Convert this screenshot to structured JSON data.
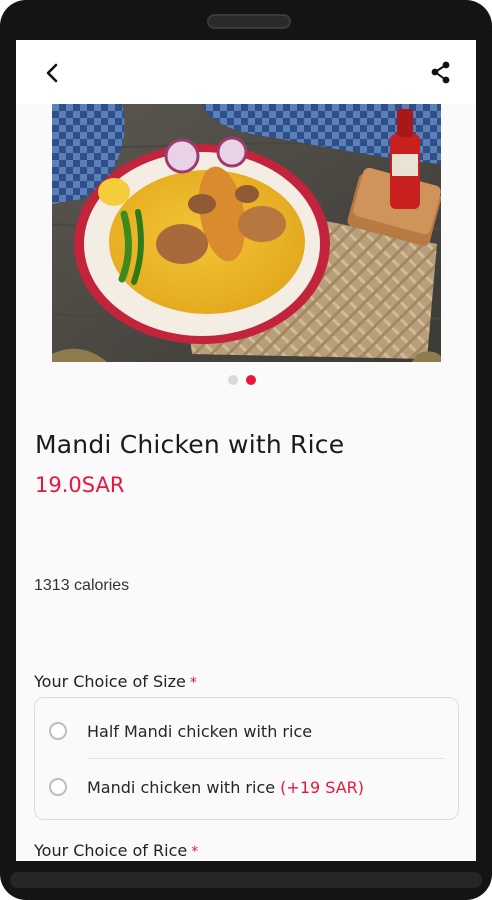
{
  "product": {
    "name": "Mandi Chicken with Rice",
    "price": "19.0SAR",
    "calories": "1313 calories"
  },
  "icons": {
    "back": "arrow-back-icon",
    "share": "share-icon"
  },
  "carousel": {
    "slide_count": 2,
    "active_index": 1
  },
  "size_section": {
    "title": "Your Choice of Size",
    "required_mark": "*",
    "options": [
      {
        "label": "Half Mandi chicken with rice",
        "extra": ""
      },
      {
        "label": "Mandi chicken with rice",
        "extra": "(+19 SAR)"
      }
    ]
  },
  "rice_section": {
    "title": "Your Choice of Rice",
    "required_mark": "*"
  },
  "colors": {
    "accent": "#e8173a",
    "text": "#1b1b1b",
    "background": "#fafafa"
  }
}
